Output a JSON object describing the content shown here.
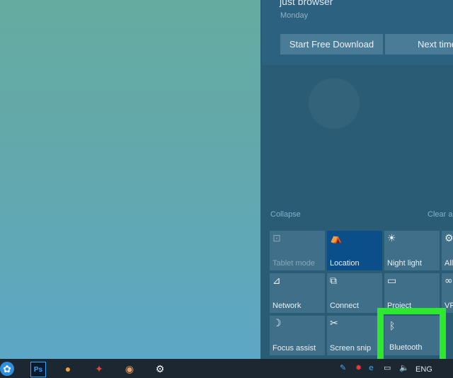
{
  "notification": {
    "title": "just browser",
    "day": "Monday",
    "buttons": {
      "download": "Start Free Download",
      "later": "Next time"
    }
  },
  "action_center": {
    "collapse": "Collapse",
    "clear_all": "Clear all",
    "tiles": [
      {
        "label": "Tablet mode",
        "icon": "tablet-mode-icon",
        "glyph": "⊡",
        "state": "disabled"
      },
      {
        "label": "Location",
        "icon": "location-icon",
        "glyph": "⛺",
        "state": "on"
      },
      {
        "label": "Night light",
        "icon": "night-light-icon",
        "glyph": "☀",
        "state": "off"
      },
      {
        "label": "All",
        "icon": "settings-icon",
        "glyph": "⚙",
        "state": "off"
      },
      {
        "label": "Network",
        "icon": "network-icon",
        "glyph": "⊿",
        "state": "off"
      },
      {
        "label": "Connect",
        "icon": "connect-icon",
        "glyph": "⧉",
        "state": "off"
      },
      {
        "label": "Project",
        "icon": "project-icon",
        "glyph": "▭",
        "state": "off"
      },
      {
        "label": "VP",
        "icon": "vpn-icon",
        "glyph": "∞",
        "state": "off"
      },
      {
        "label": "Focus assist",
        "icon": "focus-assist-icon",
        "glyph": "☽",
        "state": "off"
      },
      {
        "label": "Screen snip",
        "icon": "screen-snip-icon",
        "glyph": "✂",
        "state": "off"
      },
      {
        "label": "Bluetooth",
        "icon": "bluetooth-icon",
        "glyph": "ᛒ",
        "state": "off"
      }
    ]
  },
  "taskbar": {
    "language": "ENG",
    "apps": [
      "start-icon",
      "photoshop-icon",
      "browser-icon",
      "app-icon",
      "music-icon",
      "settings-gear-icon"
    ],
    "photoshop_text": "Ps"
  },
  "colors": {
    "highlight": "#2ee830",
    "tile_active": "#0a4f8a",
    "tile": "#3f6f89"
  }
}
